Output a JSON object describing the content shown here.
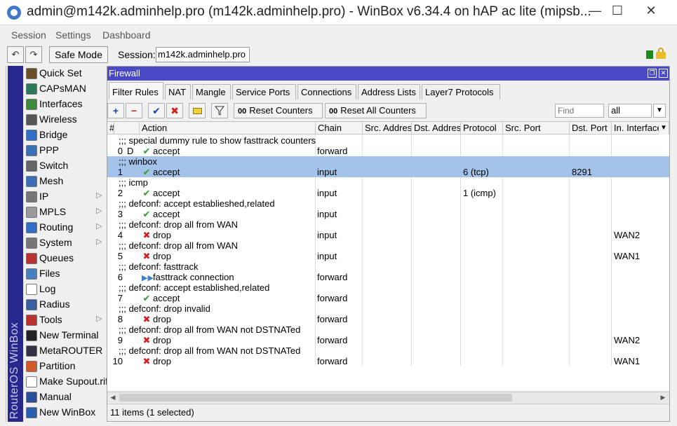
{
  "window": {
    "title": "admin@m142k.adminhelp.pro (m142k.adminhelp.pro) - WinBox v6.34.4 on hAP ac lite (mipsb...",
    "min": "—",
    "max": "☐",
    "close": "✕"
  },
  "menu": {
    "session": "Session",
    "settings": "Settings",
    "dashboard": "Dashboard"
  },
  "toolbar": {
    "undo": "↶",
    "redo": "↷",
    "safe_mode": "Safe Mode",
    "session_label": "Session:",
    "session_value": "m142k.adminhelp.pro"
  },
  "sidebar": {
    "brand": "RouterOS WinBox",
    "items": [
      {
        "label": "Quick Set",
        "icon": "quick-set-icon",
        "arrow": ""
      },
      {
        "label": "CAPsMAN",
        "icon": "capsman-icon",
        "arrow": ""
      },
      {
        "label": "Interfaces",
        "icon": "interfaces-icon",
        "arrow": ""
      },
      {
        "label": "Wireless",
        "icon": "wireless-icon",
        "arrow": ""
      },
      {
        "label": "Bridge",
        "icon": "bridge-icon",
        "arrow": ""
      },
      {
        "label": "PPP",
        "icon": "ppp-icon",
        "arrow": ""
      },
      {
        "label": "Switch",
        "icon": "switch-icon",
        "arrow": ""
      },
      {
        "label": "Mesh",
        "icon": "mesh-icon",
        "arrow": ""
      },
      {
        "label": "IP",
        "icon": "ip-icon",
        "arrow": "▷"
      },
      {
        "label": "MPLS",
        "icon": "mpls-icon",
        "arrow": "▷"
      },
      {
        "label": "Routing",
        "icon": "routing-icon",
        "arrow": "▷"
      },
      {
        "label": "System",
        "icon": "system-icon",
        "arrow": "▷"
      },
      {
        "label": "Queues",
        "icon": "queues-icon",
        "arrow": ""
      },
      {
        "label": "Files",
        "icon": "files-icon",
        "arrow": ""
      },
      {
        "label": "Log",
        "icon": "log-icon",
        "arrow": ""
      },
      {
        "label": "Radius",
        "icon": "radius-icon",
        "arrow": ""
      },
      {
        "label": "Tools",
        "icon": "tools-icon",
        "arrow": "▷"
      },
      {
        "label": "New Terminal",
        "icon": "terminal-icon",
        "arrow": ""
      },
      {
        "label": "MetaROUTER",
        "icon": "metarouter-icon",
        "arrow": ""
      },
      {
        "label": "Partition",
        "icon": "partition-icon",
        "arrow": ""
      },
      {
        "label": "Make Supout.rif",
        "icon": "supout-icon",
        "arrow": ""
      },
      {
        "label": "Manual",
        "icon": "manual-icon",
        "arrow": ""
      },
      {
        "label": "New WinBox",
        "icon": "winbox-icon",
        "arrow": ""
      }
    ]
  },
  "firewall": {
    "title": "Firewall",
    "tabs": [
      "Filter Rules",
      "NAT",
      "Mangle",
      "Service Ports",
      "Connections",
      "Address Lists",
      "Layer7 Protocols"
    ],
    "tools": {
      "add": "+",
      "remove": "−",
      "enable": "✔",
      "disable": "✖",
      "comment": "",
      "filter": "",
      "reset_counters": "Reset Counters",
      "reset_all_counters": "Reset All Counters",
      "oo": "00",
      "find_placeholder": "Find",
      "filter_value": "all",
      "filter_arrow": "▼"
    },
    "columns": [
      "#",
      "",
      "Action",
      "Chain",
      "Src. Address",
      "Dst. Address",
      "Protocol",
      "Src. Port",
      "Dst. Port",
      "In. Interface"
    ],
    "rows": [
      {
        "comment": ";;; special dummy rule to show fasttrack counters",
        "num": "0",
        "flag": "D",
        "action": "accept",
        "chain": "forward",
        "protocol": "",
        "dst_port": "",
        "in_iface": "",
        "selected": false
      },
      {
        "comment": ";;; winbox",
        "num": "1",
        "flag": "",
        "action": "accept",
        "chain": "input",
        "protocol": "6 (tcp)",
        "dst_port": "8291",
        "in_iface": "",
        "selected": true
      },
      {
        "comment": ";;; icmp",
        "num": "2",
        "flag": "",
        "action": "accept",
        "chain": "input",
        "protocol": "1 (icmp)",
        "dst_port": "",
        "in_iface": "",
        "selected": false
      },
      {
        "comment": ";;; defconf: accept establieshed,related",
        "num": "3",
        "flag": "",
        "action": "accept",
        "chain": "input",
        "protocol": "",
        "dst_port": "",
        "in_iface": "",
        "selected": false
      },
      {
        "comment": ";;; defconf: drop all from WAN",
        "num": "4",
        "flag": "",
        "action": "drop",
        "chain": "input",
        "protocol": "",
        "dst_port": "",
        "in_iface": "WAN2",
        "selected": false
      },
      {
        "comment": ";;; defconf: drop all from WAN",
        "num": "5",
        "flag": "",
        "action": "drop",
        "chain": "input",
        "protocol": "",
        "dst_port": "",
        "in_iface": "WAN1",
        "selected": false
      },
      {
        "comment": ";;; defconf: fasttrack",
        "num": "6",
        "flag": "",
        "action": "fasttrack connection",
        "chain": "forward",
        "protocol": "",
        "dst_port": "",
        "in_iface": "",
        "selected": false
      },
      {
        "comment": ";;; defconf: accept established,related",
        "num": "7",
        "flag": "",
        "action": "accept",
        "chain": "forward",
        "protocol": "",
        "dst_port": "",
        "in_iface": "",
        "selected": false
      },
      {
        "comment": ";;; defconf: drop invalid",
        "num": "8",
        "flag": "",
        "action": "drop",
        "chain": "forward",
        "protocol": "",
        "dst_port": "",
        "in_iface": "",
        "selected": false
      },
      {
        "comment": ";;; defconf:  drop all from WAN not DSTNATed",
        "num": "9",
        "flag": "",
        "action": "drop",
        "chain": "forward",
        "protocol": "",
        "dst_port": "",
        "in_iface": "WAN2",
        "selected": false
      },
      {
        "comment": ";;; defconf:  drop all from WAN not DSTNATed",
        "num": "10",
        "flag": "",
        "action": "drop",
        "chain": "forward",
        "protocol": "",
        "dst_port": "",
        "in_iface": "WAN1",
        "selected": false
      }
    ],
    "status": "11 items (1 selected)",
    "scroll_left": "◀",
    "scroll_right": "▶"
  },
  "colors": {
    "sidebar_brand_bg": "#27278d",
    "window_title_bg": "#4a4ac7",
    "selected_row": "#a3c3ea",
    "accept": "#2e9e2e",
    "drop": "#d42020"
  }
}
